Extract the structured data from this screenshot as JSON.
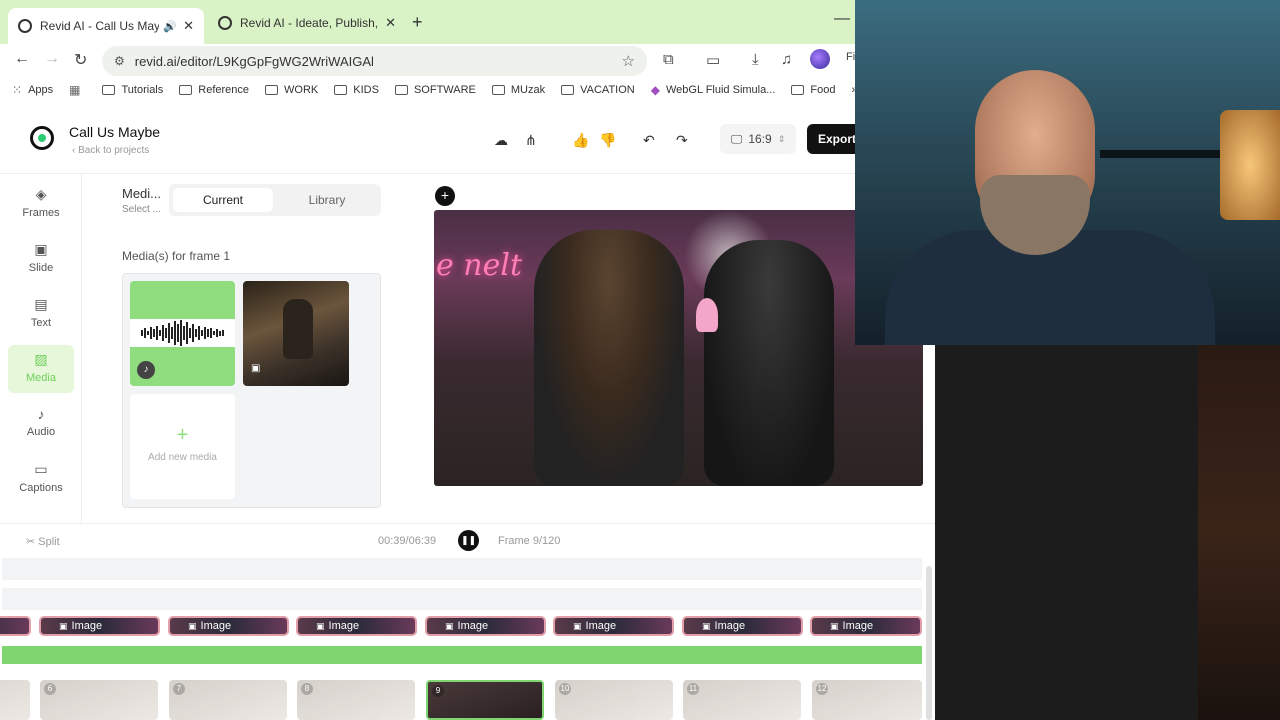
{
  "browser": {
    "tabs": [
      {
        "title": "Revid AI - Call Us Maybe",
        "active": true
      },
      {
        "title": "Revid AI - Ideate, Publish, Go Vi",
        "active": false
      }
    ],
    "url": "revid.ai/editor/L9KgGpFgWG2WriWAIGAl",
    "bookmarks": [
      "Apps",
      "Tutorials",
      "Reference",
      "WORK",
      "KIDS",
      "SOFTWARE",
      "MUzak",
      "VACATION",
      "WebGL Fluid Simula...",
      "Food"
    ],
    "profile_partial": "Fi"
  },
  "app": {
    "project_title": "Call Us Maybe",
    "back_link": "Back to projects",
    "aspect_ratio": "16:9",
    "export_label": "Export",
    "sidebar": [
      {
        "label": "Frames",
        "icon": "layers-icon"
      },
      {
        "label": "Slide",
        "icon": "slide-icon"
      },
      {
        "label": "Text",
        "icon": "text-icon"
      },
      {
        "label": "Media",
        "icon": "media-icon",
        "active": true
      },
      {
        "label": "Audio",
        "icon": "music-note-icon"
      },
      {
        "label": "Captions",
        "icon": "captions-icon"
      }
    ],
    "media_panel": {
      "title": "Medi...",
      "subtitle": "Select ...",
      "tab_current": "Current",
      "tab_library": "Library",
      "section_label": "Media(s) for frame 1",
      "add_media": "Add new media"
    },
    "timeline": {
      "split_label": "Split",
      "time": "00:39/06:39",
      "frame": "Frame 9/120",
      "chip_label": "Image",
      "thumb_numbers": [
        "",
        "6",
        "7",
        "8",
        "9",
        "10",
        "11",
        "12"
      ]
    },
    "colors": {
      "accent_green": "#7fd670",
      "tab_bar": "#d9f3c6",
      "export_bg": "#111111"
    }
  }
}
